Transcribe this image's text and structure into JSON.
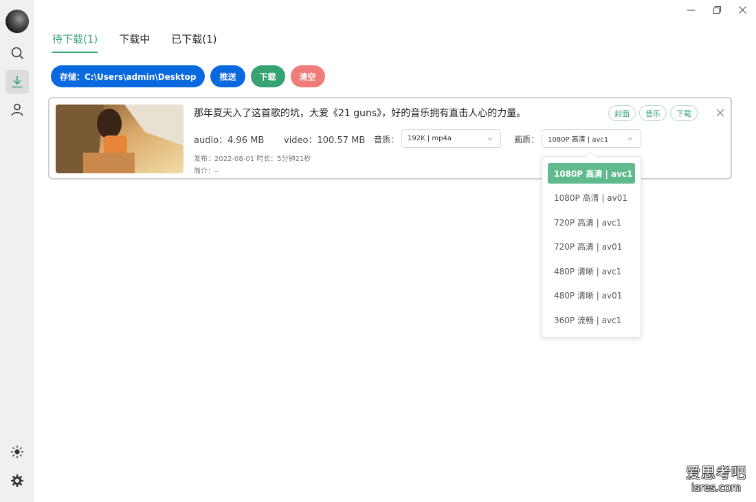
{
  "tabs": [
    {
      "label": "待下载(1)",
      "active": true
    },
    {
      "label": "下载中",
      "active": false
    },
    {
      "label": "已下载(1)",
      "active": false
    }
  ],
  "actions": {
    "storage_label": "存储：C:\\Users\\admin\\Desktop",
    "push_label": "推送",
    "download_label": "下载",
    "clear_label": "清空"
  },
  "item": {
    "title": "那年夏天入了这首歌的坑，大爱《21 guns》，好的音乐拥有直击人心的力量。",
    "tags": [
      "封面",
      "音乐",
      "下载"
    ],
    "audio_label": "audio：",
    "audio_size": "4.96 MB",
    "video_label": "video：",
    "video_size": "100.57 MB",
    "audio_quality_label": "音质：",
    "audio_quality_value": "192K | mp4a",
    "video_quality_label": "画质：",
    "video_quality_value": "1080P 高清 | avc1",
    "publish_text": "发布：2022-08-01  时长：5分钟21秒",
    "intro_text": "简介：–"
  },
  "dropdown": {
    "options": [
      "1080P 高清 | avc1",
      "1080P 高清 | av01",
      "720P 高清 | avc1",
      "720P 高清 | av01",
      "480P 清晰 | avc1",
      "480P 清晰 | av01",
      "360P 流畅 | avc1"
    ],
    "selected_index": 0
  },
  "watermark": {
    "line1": "爱思考吧",
    "line2": "isres.com"
  },
  "sidebar_icons": [
    "avatar",
    "search-icon",
    "download-icon",
    "user-icon",
    "theme-sun-icon",
    "settings-gear-icon"
  ],
  "colors": {
    "accent_green": "#36a372",
    "primary_blue": "#0b69e0",
    "danger_red": "#f07b78",
    "selected_option": "#5fbb8e"
  }
}
